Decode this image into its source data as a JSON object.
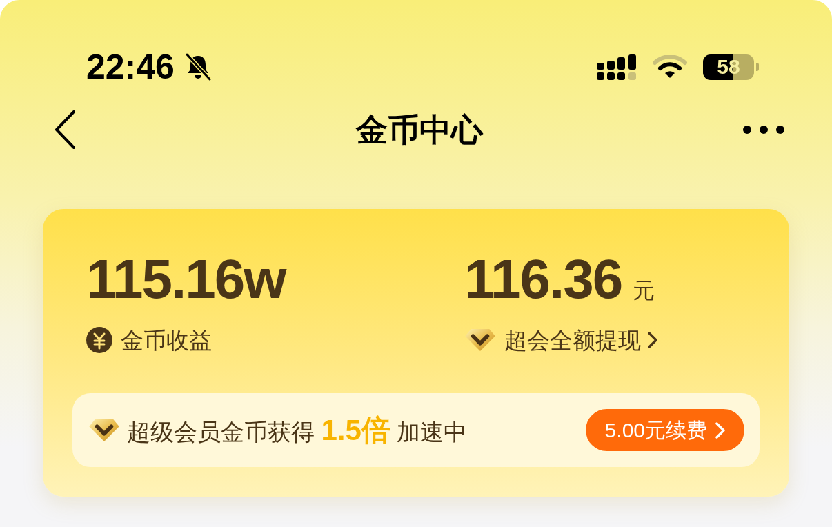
{
  "status_bar": {
    "time": "22:46",
    "battery": {
      "text": "58",
      "level": 0.58
    }
  },
  "nav": {
    "title": "金币中心"
  },
  "card": {
    "stats": [
      {
        "kind": "coins",
        "value": "115.16w",
        "label": "金币收益",
        "link": false
      },
      {
        "kind": "cash",
        "value": "116.36",
        "unit": "元",
        "label": "超会全额提现",
        "link": true
      }
    ],
    "banner": {
      "text": "超级会员金币获得 **1.5倍** 加速中",
      "button": "5.00元续费"
    }
  }
}
